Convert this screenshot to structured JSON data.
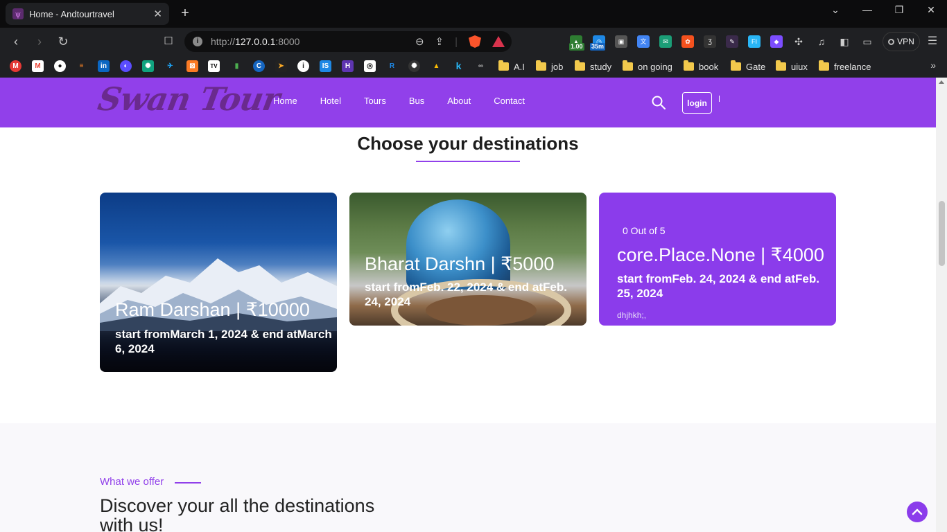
{
  "browser": {
    "tab_title": "Home - Andtourtravel",
    "url_scheme": "http://",
    "url_host": "127.0.0.1",
    "url_port": ":8000",
    "ext_badge_1": "1.00",
    "ext_badge_2": "35m",
    "vpn_label": "VPN",
    "bookmark_folders": [
      "A.I",
      "job",
      "study",
      "on going",
      "book",
      "Gate",
      "uiux",
      "freelance"
    ]
  },
  "site": {
    "nav": [
      "Home",
      "Hotel",
      "Tours",
      "Bus",
      "About",
      "Contact"
    ],
    "login_label": "login",
    "section_title": "Choose your destinations",
    "cards": [
      {
        "title": "Ram Darshan | ₹10000",
        "dates": "start fromMarch 1, 2024 & end atMarch 6, 2024"
      },
      {
        "title": "Bharat Darshn | ₹5000",
        "dates": "start fromFeb. 22, 2024 & end atFeb. 24, 2024"
      },
      {
        "rating": "0 Out of 5",
        "title": "core.Place.None | ₹4000",
        "dates": "start fromFeb. 24, 2024 & end atFeb. 25, 2024",
        "desc": "dhjhkh;,"
      }
    ],
    "offer_tag": "What we offer",
    "offer_title": "Discover your all the destinations with us!"
  },
  "colors": {
    "brand": "#9140ea",
    "card_purple": "#8b3ceb",
    "chrome_dark": "#1f2023"
  }
}
